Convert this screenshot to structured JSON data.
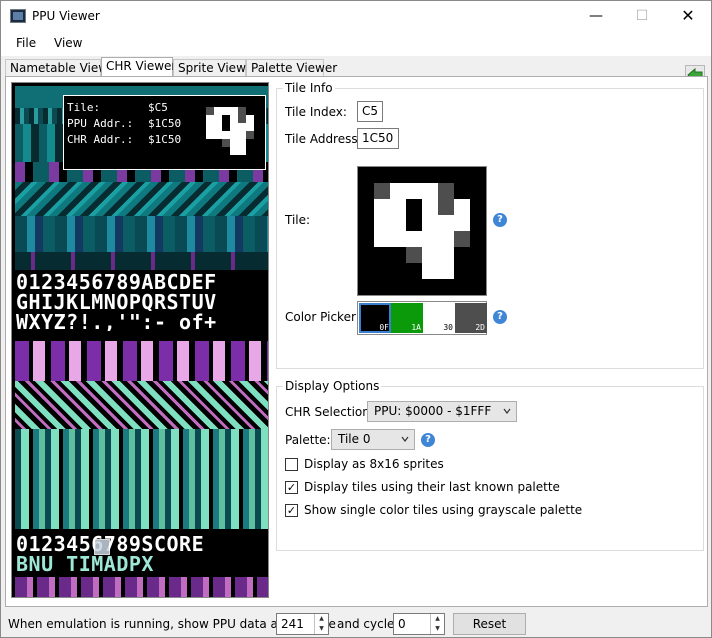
{
  "window": {
    "title": "PPU Viewer",
    "controls": {
      "minimize": "—",
      "maximize": "☐",
      "close": "✕"
    }
  },
  "menu": {
    "items": [
      "File",
      "View"
    ]
  },
  "tabs": [
    "Nametable Viewer",
    "CHR Viewer",
    "Sprite Viewer",
    "Palette Viewer"
  ],
  "active_tab": "CHR Viewer",
  "chr_view": {
    "glyph_rows_top": [
      "0123456789ABCDEF",
      "GHIJKLMNOPQRSTUV",
      "WXYZ?!.,'\":- of+"
    ],
    "glyph_rows_bottom": [
      "0123456789SCORE",
      "BNU TIMADPX"
    ],
    "tooltip": {
      "tile_label": "Tile:",
      "tile_value": "$C5",
      "ppu_label": "PPU Addr.:",
      "ppu_value": "$1C50",
      "chr_label": "CHR Addr.:",
      "chr_value": "$1C50"
    }
  },
  "tile_info": {
    "legend": "Tile Info",
    "tile_index_label": "Tile Index:",
    "tile_index_value": "C5",
    "tile_address_label": "Tile Address:",
    "tile_address_value": "1C50",
    "tile_label": "Tile:",
    "color_picker_label": "Color Picker:",
    "palette_swatches": [
      {
        "code": "0F",
        "color": "#000000",
        "text_color": "#ffffff",
        "selected": true
      },
      {
        "code": "1A",
        "color": "#0a9a0a",
        "text_color": "#ffffff",
        "selected": false
      },
      {
        "code": "30",
        "color": "#ffffff",
        "text_color": "#000000",
        "selected": false
      },
      {
        "code": "2D",
        "color": "#4e4e4e",
        "text_color": "#ffffff",
        "selected": false
      }
    ],
    "tile_pixels": [
      "00000000",
      "03222300",
      "02201310",
      "02201210",
      "02222230",
      "00032200",
      "00002200",
      "00000000"
    ],
    "pixel_colors": [
      "#000000",
      "#ffffff",
      "#ffffff",
      "#4e4e4e"
    ]
  },
  "display_options": {
    "legend": "Display Options",
    "chr_selection_label": "CHR Selection:",
    "chr_selection_value": "PPU: $0000 - $1FFF",
    "palette_label": "Palette:",
    "palette_value": "Tile 0",
    "checkboxes": [
      {
        "label": "Display as 8x16 sprites",
        "checked": false
      },
      {
        "label": "Display tiles using their last known palette",
        "checked": true
      },
      {
        "label": "Show single color tiles using grayscale palette",
        "checked": true
      }
    ]
  },
  "statusbar": {
    "scanline_label": "When emulation is running, show PPU data at scanline",
    "scanline_value": "241",
    "cycle_label": "and cycle",
    "cycle_value": "0",
    "reset_label": "Reset"
  },
  "colors": {
    "accent": "#3f87d6",
    "back_arrow": "#3aa63a"
  },
  "icons": {
    "help": "?",
    "checked": "✓"
  }
}
